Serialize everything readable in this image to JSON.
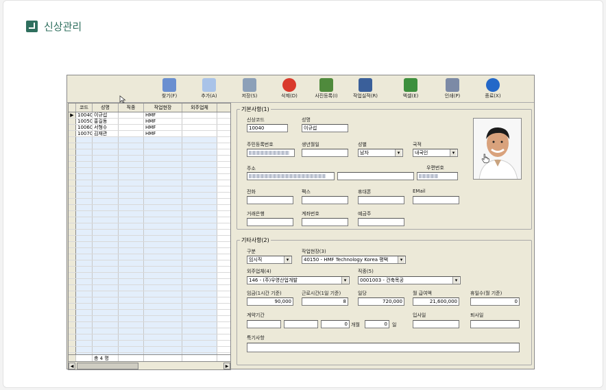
{
  "page": {
    "title": "신상관리"
  },
  "toolbar": {
    "buttons": [
      {
        "label": "찾기(F)",
        "icon": "search-icon",
        "color": "#6a8fd0"
      },
      {
        "label": "추가(A)",
        "icon": "add-icon",
        "color": "#a9c3e8"
      },
      {
        "label": "저장(S)",
        "icon": "save-icon",
        "color": "#8ca0b8"
      },
      {
        "label": "삭제(D)",
        "icon": "delete-icon",
        "color": "#d93a2c"
      },
      {
        "label": "사진등록(I)",
        "icon": "photo-register-icon",
        "color": "#4f8a3c"
      },
      {
        "label": "작업실적(R)",
        "icon": "work-record-icon",
        "color": "#3a5f9a"
      },
      {
        "label": "엑셀(E)",
        "icon": "excel-icon",
        "color": "#3d8f3d"
      },
      {
        "label": "인쇄(P)",
        "icon": "print-icon",
        "color": "#7c8aa6"
      },
      {
        "label": "종료(X)",
        "icon": "power-icon",
        "color": "#2468c8"
      }
    ]
  },
  "grid": {
    "headers": [
      "코드",
      "성명",
      "직종",
      "작업현장",
      "외주업체"
    ],
    "rows": [
      [
        "10040",
        "이규섭",
        "",
        "HMF",
        ""
      ],
      [
        "10050",
        "홍길동",
        "",
        "HMF",
        ""
      ],
      [
        "10060",
        "서형수",
        "",
        "HMF",
        ""
      ],
      [
        "10070",
        "김재관",
        "",
        "HMF",
        ""
      ]
    ],
    "footer_count": "총 4 명"
  },
  "basic": {
    "legend": "기본사항(1)",
    "code_label": "신상코드",
    "code_value": "10040",
    "name_label": "성명",
    "name_value": "이규섭",
    "rrn_label": "주민등록번호",
    "birth_label": "생년월일",
    "gender_label": "성별",
    "gender_value": "남자",
    "nation_label": "국적",
    "nation_value": "내국인",
    "addr_label": "주소",
    "zip_label": "우편번호",
    "phone_label": "전화",
    "fax_label": "팩스",
    "mobile_label": "휴대폰",
    "email_label": "EMail",
    "bank_label": "거래은행",
    "account_label": "계좌번호",
    "holder_label": "예금주"
  },
  "extra": {
    "legend": "기타사항(2)",
    "type_label": "구분",
    "type_value": "임시직",
    "site_label": "작업현장(3)",
    "site_value": "40150 - HMF Technology Korea 평택",
    "vendor_label": "외주업체(4)",
    "vendor_value": "146 - (주)우영산업개발",
    "job_label": "직종(5)",
    "job_value": "0001003 - 건축목공",
    "wage_label": "임금(1시간 기준)",
    "wage_value": "90,000",
    "hours_label": "근로시간(1일 기준)",
    "hours_value": "8",
    "daily_label": "일당",
    "daily_value": "720,000",
    "monthly_label": "월 급여액",
    "monthly_value": "21,600,000",
    "holiday_label": "휴일수(월 기준)",
    "holiday_value": "0",
    "contract_label": "계약기간",
    "months_value": "0",
    "months_unit": "개월",
    "days_value": "0",
    "days_unit": "일",
    "hire_label": "입사일",
    "leave_label": "퇴사일",
    "remark_label": "특기사항"
  }
}
